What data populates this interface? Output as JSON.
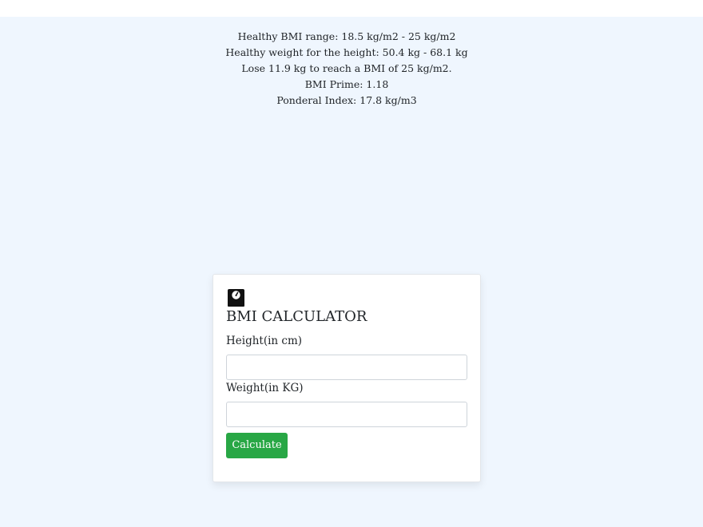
{
  "results": {
    "healthy_range": "Healthy BMI range: 18.5 kg/m2 - 25 kg/m2",
    "healthy_weight": "Healthy weight for the height: 50.4 kg - 68.1 kg",
    "lose_message": "Lose 11.9 kg to reach a BMI of 25 kg/m2.",
    "bmi_prime": "BMI Prime: 1.18",
    "ponderal_index": "Ponderal Index: 17.8 kg/m3"
  },
  "calculator": {
    "icon": "weight-scale-icon",
    "title": "BMI CALCULATOR",
    "height_label": "Height(in cm)",
    "height_value": "",
    "weight_label": "Weight(in KG)",
    "weight_value": "",
    "calculate_label": "Calculate",
    "button_color": "#28a745"
  },
  "colors": {
    "page_background": "#eff6fe",
    "header_background": "#ffffff"
  }
}
